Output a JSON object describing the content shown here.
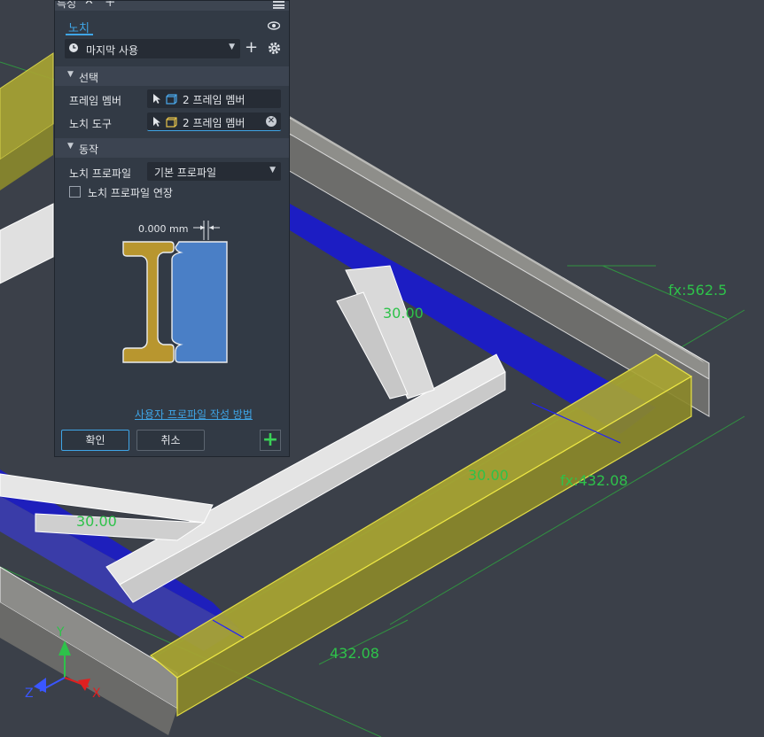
{
  "panel": {
    "tab_title": "특성",
    "feature_tab": "노치",
    "preset": "마지막 사용",
    "section_selection": "선택",
    "frame_member_label": "프레임 멤버",
    "frame_member_value": "2 프레임 멤버",
    "notch_tool_label": "노치 도구",
    "notch_tool_value": "2 프레임 멤버",
    "section_behavior": "동작",
    "notch_profile_label": "노치 프로파일",
    "notch_profile_value": "기본 프로파일",
    "extend_profile_label": "노치 프로파일 연장",
    "extend_profile_checked": false,
    "offset_value": "0.000 mm",
    "help_link": "사용자 프로파일 작성 방법",
    "ok_label": "확인",
    "cancel_label": "취소"
  },
  "viewport": {
    "dimensions": [
      "30.00",
      "fx:562.5",
      "fx:432.08",
      "30.00",
      "30.00",
      "432.08"
    ],
    "axes": [
      "Y",
      "Z",
      "X"
    ]
  },
  "colors": {
    "accent": "#3fa5e6",
    "dimension_text": "#2ec24a",
    "highlight_yellow": "#c9c43a",
    "beam_blue": "#1a1ad0"
  }
}
